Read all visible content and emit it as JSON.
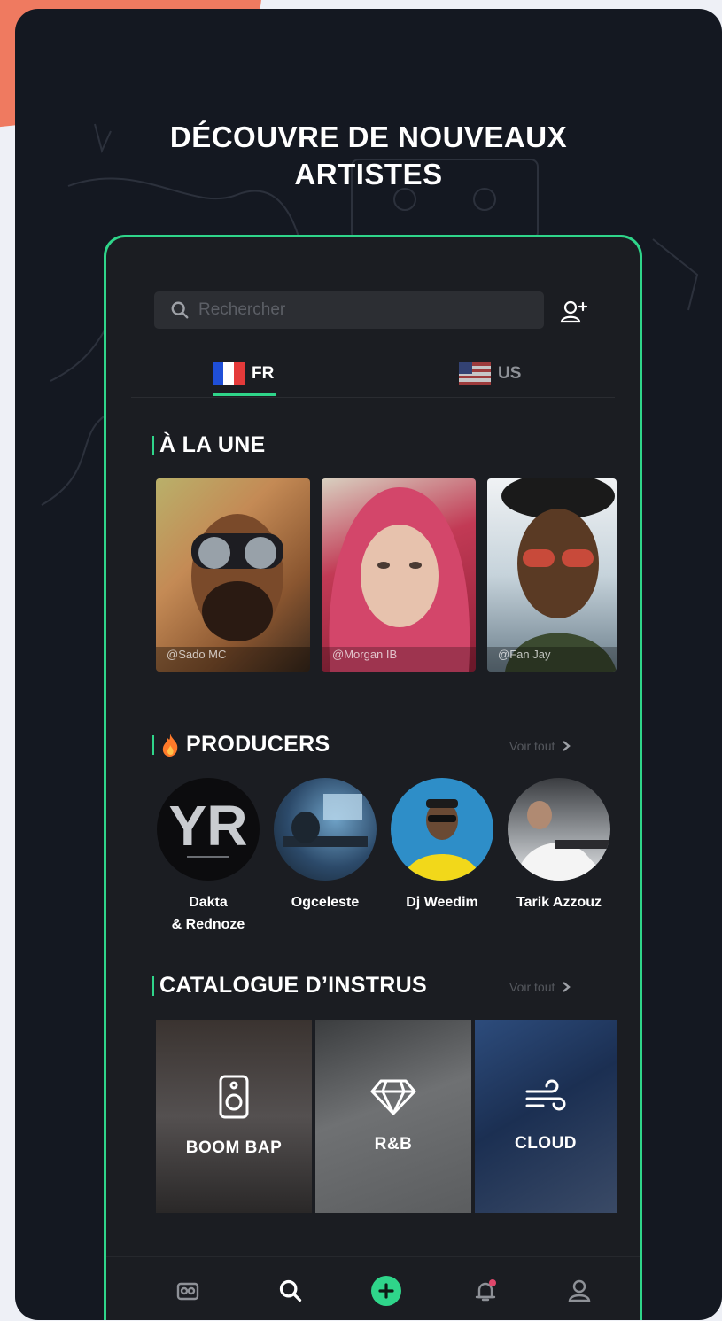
{
  "headline": {
    "line1": "DÉCOUVRE DE NOUVEAUX",
    "line2": "ARTISTES"
  },
  "search": {
    "placeholder": "Rechercher",
    "icon": "search-icon"
  },
  "tabs": [
    {
      "label": "FR",
      "icon": "france-flag-icon",
      "active": true
    },
    {
      "label": "US",
      "icon": "us-flag-icon",
      "active": false
    }
  ],
  "featured": {
    "title": "À LA UNE",
    "items": [
      {
        "handle": "@Sado MC"
      },
      {
        "handle": "@Morgan IB"
      },
      {
        "handle": "@Fan Jay"
      }
    ]
  },
  "producers": {
    "title": "PRODUCERS",
    "title_icon": "fire-icon",
    "see_all": "Voir tout",
    "items": [
      {
        "name": "Dakta\n& Rednoze",
        "logo_text": "YR"
      },
      {
        "name": "Ogceleste"
      },
      {
        "name": "Dj Weedim"
      },
      {
        "name": "Tarik Azzouz"
      }
    ]
  },
  "catalogue": {
    "title": "CATALOGUE D’INSTRUS",
    "see_all": "Voir tout",
    "genres": [
      {
        "label": "BOOM BAP",
        "icon": "speaker-icon"
      },
      {
        "label": "R&B",
        "icon": "diamond-icon"
      },
      {
        "label": "CLOUD",
        "icon": "wind-icon"
      }
    ]
  },
  "nav": {
    "items": [
      "cassette-icon",
      "search-icon",
      "add-icon",
      "notification-icon",
      "profile-icon"
    ],
    "active": "search-icon",
    "accent": "#2fd58a",
    "badge_color": "#e0476b"
  },
  "colors": {
    "background": "#141821",
    "accent": "#2fd58a",
    "coral": "#ef7a60"
  }
}
